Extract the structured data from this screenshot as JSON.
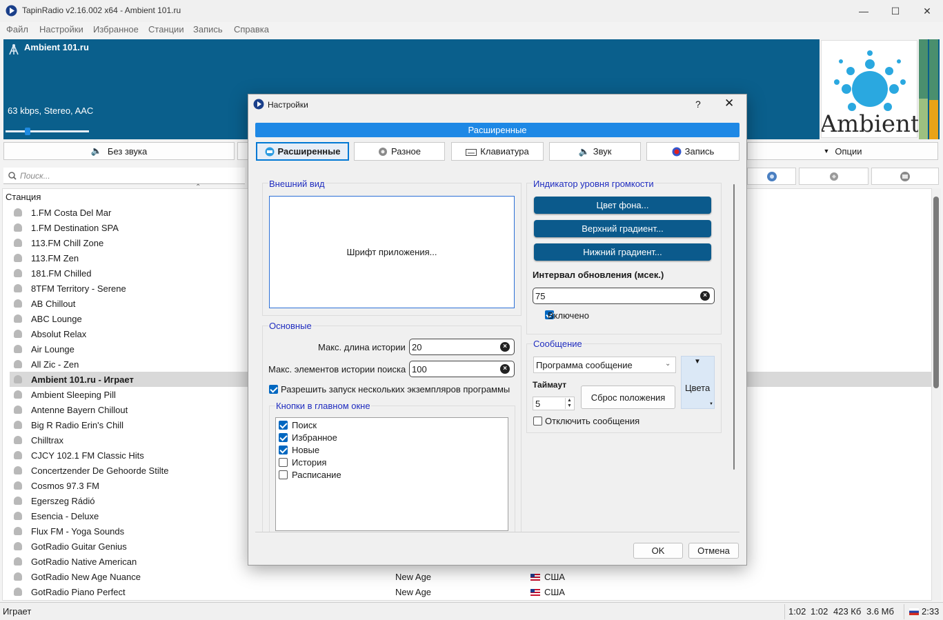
{
  "window": {
    "title": "TapinRadio v2.16.002   x64  - Ambient 101.ru"
  },
  "menu": [
    "Файл",
    "Настройки",
    "Избранное",
    "Станции",
    "Запись",
    "Справка"
  ],
  "player": {
    "station": "Ambient 101.ru",
    "stream_info": "63 kbps, Stereo, AAC",
    "volume": 0.25,
    "logo_text": "Ambient"
  },
  "controls": {
    "mute": "Без звука",
    "options": "Опции"
  },
  "search": {
    "placeholder": "Поиск..."
  },
  "list": {
    "column": "Станция",
    "rows": [
      {
        "name": "1.FM Costa Del Mar"
      },
      {
        "name": "1.FM Destination SPA"
      },
      {
        "name": "113.FM Chill Zone"
      },
      {
        "name": "113.FM Zen"
      },
      {
        "name": "181.FM Chilled"
      },
      {
        "name": "8TFM Territory - Serene"
      },
      {
        "name": "AB Chillout"
      },
      {
        "name": "ABC Lounge"
      },
      {
        "name": "Absolut Relax"
      },
      {
        "name": "Air Lounge"
      },
      {
        "name": "All Zic - Zen"
      },
      {
        "name": "Ambient 101.ru - Играет",
        "playing": true
      },
      {
        "name": "Ambient Sleeping Pill"
      },
      {
        "name": "Antenne Bayern Chillout"
      },
      {
        "name": "Big R Radio Erin's Chill"
      },
      {
        "name": "Chilltrax"
      },
      {
        "name": "CJCY 102.1 FM Classic Hits"
      },
      {
        "name": "Concertzender De Gehoorde Stilte"
      },
      {
        "name": "Cosmos 97.3 FM"
      },
      {
        "name": "Egerszeg Rádió"
      },
      {
        "name": "Esencia - Deluxe"
      },
      {
        "name": "Flux FM - Yoga Sounds"
      },
      {
        "name": "GotRadio Guitar Genius"
      },
      {
        "name": "GotRadio Native American"
      },
      {
        "name": "GotRadio New Age Nuance",
        "genre": "New Age",
        "country": "США"
      },
      {
        "name": "GotRadio Piano Perfect",
        "genre": "New Age",
        "country": "США"
      }
    ]
  },
  "status": {
    "text": "Играет",
    "t1": "1:02",
    "t2": "1:02",
    "size1": "423 Кб",
    "size2": "3.6 Мб",
    "clock": "2:33"
  },
  "dialog": {
    "title": "Настройки",
    "help": "?",
    "close": "✕",
    "banner": "Расширенные",
    "tabs": [
      "Расширенные",
      "Разное",
      "Клавиатура",
      "Звук",
      "Запись"
    ],
    "appearance": {
      "title": "Внешний вид",
      "font_button": "Шрифт приложения..."
    },
    "basic": {
      "title": "Основные",
      "history_label": "Макс. длина истории",
      "history_value": "20",
      "search_history_label": "Макс. элементов истории поиска",
      "search_history_value": "100",
      "multi_instance": "Разрешить запуск нескольких экземпляров программы"
    },
    "buttons": {
      "title": "Кнопки в главном окне",
      "items": [
        {
          "label": "Поиск",
          "checked": true
        },
        {
          "label": "Избранное",
          "checked": true
        },
        {
          "label": "Новые",
          "checked": true
        },
        {
          "label": "История",
          "checked": false
        },
        {
          "label": "Расписание",
          "checked": false
        }
      ]
    },
    "level": {
      "title": "Индикатор уровня громкости",
      "bg_color": "Цвет фона...",
      "top_gradient": "Верхний градиент...",
      "bottom_gradient": "Нижний градиент...",
      "interval_label": "Интервал обновления (мсек.)",
      "interval_value": "75",
      "enabled": "Включено"
    },
    "message": {
      "title": "Сообщение",
      "select": "Программа сообщение",
      "timeout_label": "Таймаут",
      "timeout_value": "5",
      "reset": "Сброс положения",
      "colors": "Цвета",
      "disable": "Отключить сообщения"
    },
    "ok": "OK",
    "cancel": "Отмена"
  }
}
